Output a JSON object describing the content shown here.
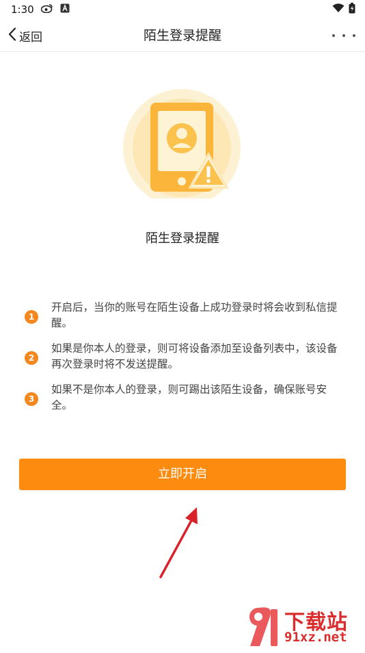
{
  "status_bar": {
    "time": "1:30"
  },
  "nav": {
    "back_label": "返回",
    "title": "陌生登录提醒"
  },
  "hero": {
    "caption": "陌生登录提醒"
  },
  "tips": [
    {
      "num": "1",
      "text": "开启后，当你的账号在陌生设备上成功登录时将会收到私信提醒。"
    },
    {
      "num": "2",
      "text": "如果是你本人的登录，则可将设备添加至设备列表中，该设备再次登录时将不发送提醒。"
    },
    {
      "num": "3",
      "text": "如果不是你本人的登录，则可踢出该陌生设备，确保账号安全。"
    }
  ],
  "enable_button": {
    "label": "立即开启"
  },
  "watermark": {
    "top": "下载站",
    "bottom": "91xz.net"
  },
  "colors": {
    "accent": "#fd8b0f",
    "badge": "#f5871f",
    "arrow": "#d9232a"
  }
}
